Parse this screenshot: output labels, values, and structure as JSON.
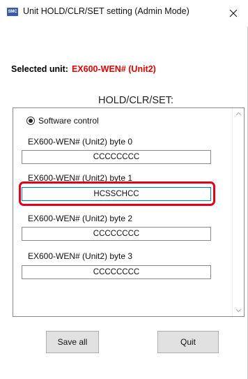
{
  "window": {
    "title": "Unit HOLD/CLR/SET setting (Admin Mode)",
    "icon_text": "SMC",
    "close_icon": "close-icon"
  },
  "selected": {
    "label": "Selected unit:",
    "value": "EX600-WEN# (Unit2)",
    "value_color": "#e00000"
  },
  "section": {
    "title": "HOLD/CLR/SET:"
  },
  "control": {
    "radio_label": "Software control",
    "radio_checked": true
  },
  "bytes": [
    {
      "label": "EX600-WEN# (Unit2)  byte 0",
      "value": "CCCCCCCC"
    },
    {
      "label": "EX600-WEN# (Unit2)  byte 1",
      "value": "HCSSCHCC"
    },
    {
      "label": "EX600-WEN# (Unit2)  byte 2",
      "value": "CCCCCCCC"
    },
    {
      "label": "EX600-WEN# (Unit2)  byte 3",
      "value": "CCCCCCCC"
    }
  ],
  "buttons": {
    "save": "Save all",
    "quit": "Quit"
  },
  "colors": {
    "highlight": "#e3001b",
    "focus_border": "#0078d7"
  }
}
